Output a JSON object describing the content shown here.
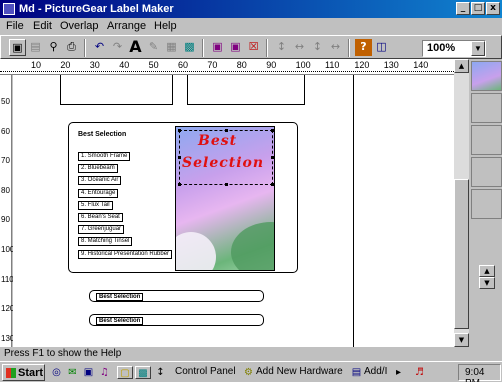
{
  "window": {
    "title": "Md - PictureGear Label Maker",
    "controls": [
      "_",
      "□",
      "x"
    ]
  },
  "menu": [
    "File",
    "Edit",
    "Overlap",
    "Arrange",
    "Help"
  ],
  "toolbar": {
    "zoom": "100%",
    "text_tool": "A"
  },
  "ruler": {
    "horizontal": [
      "10",
      "20",
      "30",
      "40",
      "50",
      "60",
      "70",
      "80",
      "90",
      "100",
      "110",
      "120",
      "130",
      "140"
    ],
    "vertical": [
      "50",
      "60",
      "70",
      "80",
      "90",
      "100",
      "110",
      "120",
      "130"
    ]
  },
  "label": {
    "heading": "Best Selection",
    "tracks": [
      "1. Smooth Frame",
      "2. Bluebeam",
      "3. Oceanic Air",
      "4. Entourage",
      "5. Flux Tail",
      "6. Bean's Seat",
      "7. Greenjuguar",
      "8. Matching Tinsel",
      "9. Historical Presentation Rubber"
    ],
    "art_line1": "Best",
    "art_line2": "Selection",
    "spine1": "Best Selection",
    "spine2": "Best Selection"
  },
  "status": {
    "message": "Press F1 to show the Help"
  },
  "taskbar": {
    "start": "Start",
    "control_panel": "Control Panel",
    "add_hardware": "Add New Hardware",
    "add_task": "Add/I",
    "clock": "9:04 PM"
  },
  "colors": {
    "title_gradient_start": "#000080",
    "title_gradient_end": "#1084d0",
    "art_text": "#e01010"
  }
}
